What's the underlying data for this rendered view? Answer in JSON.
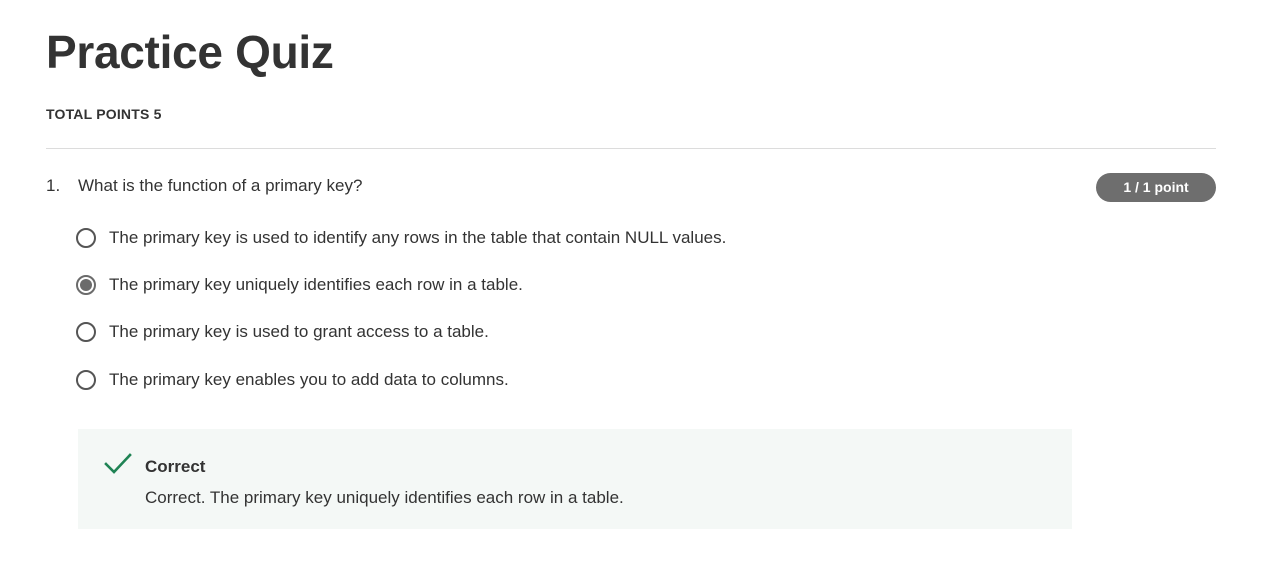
{
  "page": {
    "title": "Practice Quiz",
    "total_points": "TOTAL POINTS 5"
  },
  "question": {
    "number": "1.",
    "text": "What is the function of a primary key?",
    "score": "1 / 1 point",
    "options": [
      {
        "label": "The primary key is used to identify any rows in the table that contain NULL values.",
        "selected": false
      },
      {
        "label": "The primary key uniquely identifies each row in a table.",
        "selected": true
      },
      {
        "label": "The primary key is used to grant access to a table.",
        "selected": false
      },
      {
        "label": "The primary key enables you to add data to columns.",
        "selected": false
      }
    ]
  },
  "feedback": {
    "icon": "checkmark-icon",
    "status": "Correct",
    "message": "Correct. The primary key uniquely identifies each row in a table.",
    "accent_color": "#1f8354",
    "background_color": "#f4f8f6"
  }
}
